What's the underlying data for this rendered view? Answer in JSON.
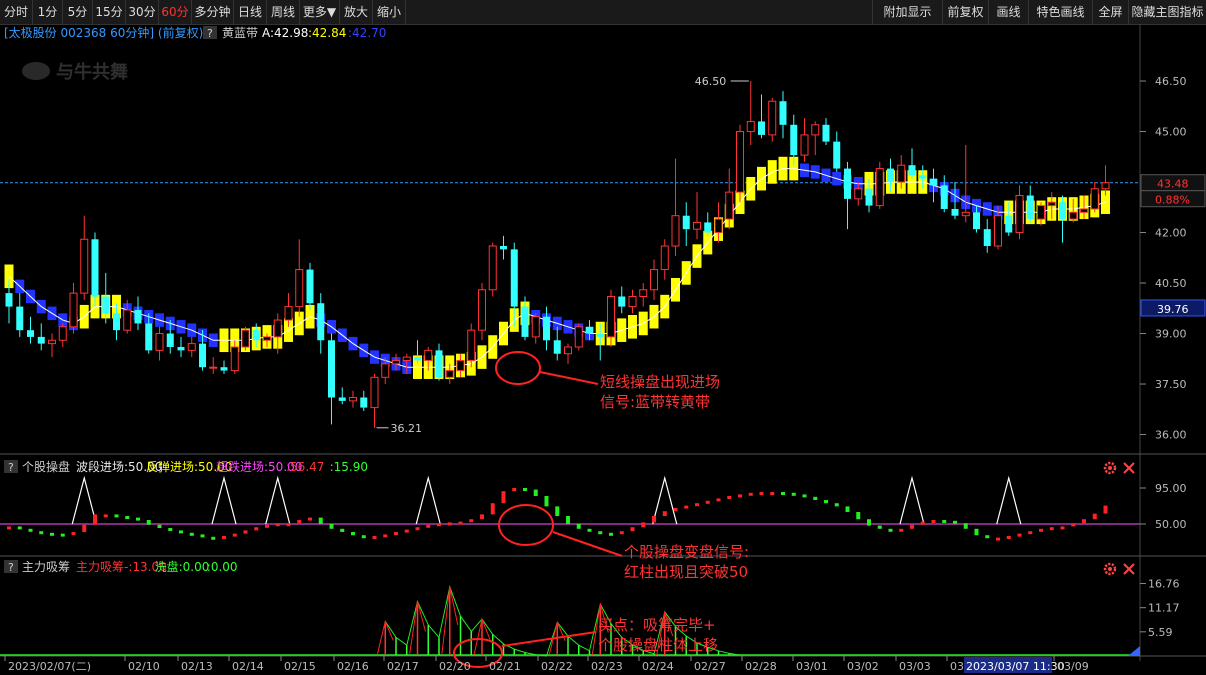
{
  "toolbar": {
    "left": [
      "分时",
      "1分",
      "5分",
      "15分",
      "30分",
      "60分",
      "多分钟",
      "日线",
      "周线",
      "更多▼",
      "放大",
      "缩小"
    ],
    "active": "60分",
    "right": [
      "附加显示",
      "前复权",
      "画线",
      "特色画线",
      "全屏",
      "隐藏主图指标"
    ]
  },
  "header": {
    "stock": "[太极股份 002368 60分钟] (前复权)",
    "help": "?",
    "indicator": "黄蓝带",
    "a_value": "A:42.98",
    "yellow_value": ":42.84",
    "blue_value": ":42.70"
  },
  "watermark": "与牛共舞",
  "price_panel": {
    "last_price": "43.48",
    "change": "0.88%",
    "bottom_tag": "39.76",
    "high_label": "46.50",
    "low_label": "36.21",
    "annotation_lines": [
      "短线操盘出现进场",
      "信号:蓝带转黄带"
    ]
  },
  "panel2": {
    "help": "?",
    "name": "个股操盘",
    "legend": [
      {
        "text": "波段进场:50.00",
        "color": "#e8e8e8"
      },
      {
        "text": "反弹进场:50.00",
        "color": "#ffff00"
      },
      {
        "text": "超跌进场:50.00",
        "color": "#ff44ff"
      },
      {
        "text": ":56.47",
        "color": "#ff3333"
      },
      {
        "text": ":15.90",
        "color": "#33ff33"
      }
    ],
    "annotation_lines": [
      "个股操盘变盘信号:",
      "红柱出现且突破50"
    ]
  },
  "panel3": {
    "help": "?",
    "name": "主力吸筹",
    "legend": [
      {
        "text": "主力吸筹-:13.00",
        "color": "#ff3333"
      },
      {
        "text": "洗盘:0.00",
        "color": "#33ff33"
      },
      {
        "text": ":0.00",
        "color": "#33ff33"
      }
    ],
    "annotation_lines": [
      "买点：吸筹完毕+",
      "个股操盘柱体上移"
    ]
  },
  "chart_data": [
    {
      "type": "candlestick",
      "title": "太极股份 002368 60分钟 (前复权)",
      "y_ticks": [
        "46.50",
        "45.00",
        "42.00",
        "40.50",
        "39.00",
        "37.50",
        "36.00"
      ],
      "ylim": [
        35.6,
        47.6
      ],
      "candles": [
        [
          40.2,
          40.6,
          39.3,
          39.8
        ],
        [
          39.8,
          40.2,
          38.9,
          39.1
        ],
        [
          39.1,
          39.5,
          38.7,
          38.9
        ],
        [
          38.9,
          39.3,
          38.5,
          38.7
        ],
        [
          38.7,
          39.0,
          38.3,
          38.8
        ],
        [
          38.8,
          39.3,
          38.6,
          39.2
        ],
        [
          39.2,
          40.5,
          39.0,
          40.2
        ],
        [
          40.2,
          42.5,
          40.0,
          41.8
        ],
        [
          41.8,
          42.0,
          39.8,
          40.1
        ],
        [
          40.1,
          40.8,
          39.3,
          39.6
        ],
        [
          39.6,
          39.9,
          38.8,
          39.1
        ],
        [
          39.1,
          40.0,
          39.0,
          39.7
        ],
        [
          39.7,
          40.1,
          39.1,
          39.3
        ],
        [
          39.3,
          39.6,
          38.4,
          38.5
        ],
        [
          38.5,
          39.2,
          38.2,
          39.0
        ],
        [
          39.0,
          39.4,
          38.4,
          38.6
        ],
        [
          38.6,
          38.9,
          38.3,
          38.5
        ],
        [
          38.5,
          38.9,
          38.3,
          38.7
        ],
        [
          38.7,
          39.1,
          37.9,
          38.0
        ],
        [
          38.0,
          38.3,
          37.8,
          38.0
        ],
        [
          38.0,
          38.2,
          37.8,
          37.9
        ],
        [
          37.9,
          38.8,
          37.8,
          38.6
        ],
        [
          38.6,
          39.2,
          38.5,
          39.1
        ],
        [
          39.1,
          39.3,
          38.6,
          38.8
        ],
        [
          38.8,
          39.0,
          38.6,
          38.9
        ],
        [
          38.9,
          39.6,
          38.4,
          39.4
        ],
        [
          39.4,
          40.2,
          39.2,
          39.8
        ],
        [
          39.8,
          41.8,
          39.5,
          40.9
        ],
        [
          40.9,
          41.1,
          39.7,
          39.9
        ],
        [
          39.9,
          40.2,
          38.4,
          38.8
        ],
        [
          38.8,
          39.0,
          36.3,
          37.1
        ],
        [
          37.1,
          37.4,
          36.9,
          37.0
        ],
        [
          37.0,
          37.3,
          36.8,
          37.1
        ],
        [
          37.1,
          37.3,
          36.7,
          36.8
        ],
        [
          36.8,
          37.8,
          36.2,
          37.7
        ],
        [
          37.7,
          38.3,
          37.5,
          38.1
        ],
        [
          38.1,
          38.4,
          37.9,
          38.2
        ],
        [
          38.2,
          38.4,
          37.8,
          38.3
        ],
        [
          38.3,
          38.8,
          38.1,
          38.2
        ],
        [
          38.2,
          38.6,
          37.9,
          38.5
        ],
        [
          38.5,
          38.7,
          37.6,
          37.7
        ],
        [
          37.7,
          38.1,
          37.5,
          37.9
        ],
        [
          37.9,
          38.4,
          37.7,
          38.2
        ],
        [
          38.2,
          39.3,
          38.0,
          39.1
        ],
        [
          39.1,
          40.5,
          38.8,
          40.3
        ],
        [
          40.3,
          41.7,
          40.1,
          41.6
        ],
        [
          41.6,
          41.9,
          41.2,
          41.5
        ],
        [
          41.5,
          41.7,
          39.2,
          39.8
        ],
        [
          39.8,
          40.1,
          38.8,
          38.9
        ],
        [
          38.9,
          39.6,
          38.7,
          39.5
        ],
        [
          39.5,
          39.8,
          38.5,
          38.8
        ],
        [
          38.8,
          39.2,
          38.2,
          38.4
        ],
        [
          38.4,
          38.7,
          38.1,
          38.6
        ],
        [
          38.6,
          39.3,
          38.5,
          39.2
        ],
        [
          39.2,
          39.4,
          38.8,
          39.0
        ],
        [
          39.0,
          39.3,
          38.2,
          38.9
        ],
        [
          38.9,
          40.3,
          38.6,
          40.1
        ],
        [
          40.1,
          40.4,
          39.6,
          39.8
        ],
        [
          39.8,
          40.3,
          39.6,
          40.1
        ],
        [
          40.1,
          40.5,
          39.8,
          40.3
        ],
        [
          40.3,
          41.2,
          40.0,
          40.9
        ],
        [
          40.9,
          41.8,
          40.6,
          41.6
        ],
        [
          41.6,
          44.2,
          41.3,
          42.5
        ],
        [
          42.5,
          42.9,
          41.6,
          42.1
        ],
        [
          42.1,
          43.2,
          41.8,
          42.3
        ],
        [
          42.3,
          42.6,
          41.9,
          42.0
        ],
        [
          42.0,
          42.9,
          41.7,
          42.4
        ],
        [
          42.4,
          43.9,
          42.1,
          43.2
        ],
        [
          43.2,
          45.2,
          42.9,
          45.0
        ],
        [
          45.0,
          46.5,
          44.6,
          45.3
        ],
        [
          45.3,
          46.1,
          44.8,
          44.9
        ],
        [
          44.9,
          46.0,
          44.7,
          45.9
        ],
        [
          45.9,
          46.2,
          44.8,
          45.2
        ],
        [
          45.2,
          45.5,
          44.0,
          44.3
        ],
        [
          44.3,
          45.4,
          44.1,
          44.9
        ],
        [
          44.9,
          45.3,
          44.3,
          45.2
        ],
        [
          45.2,
          45.4,
          44.6,
          44.7
        ],
        [
          44.7,
          45.0,
          43.8,
          43.9
        ],
        [
          43.9,
          44.1,
          42.1,
          43.0
        ],
        [
          43.0,
          43.5,
          42.8,
          43.3
        ],
        [
          43.3,
          43.6,
          42.6,
          42.8
        ],
        [
          42.8,
          44.1,
          42.7,
          43.9
        ],
        [
          43.9,
          44.2,
          43.2,
          43.5
        ],
        [
          43.5,
          44.3,
          43.3,
          44.0
        ],
        [
          44.0,
          44.5,
          43.6,
          43.7
        ],
        [
          43.7,
          44.0,
          43.3,
          43.6
        ],
        [
          43.6,
          43.9,
          42.9,
          43.4
        ],
        [
          43.4,
          43.7,
          42.6,
          42.7
        ],
        [
          42.7,
          43.5,
          42.4,
          42.5
        ],
        [
          42.5,
          44.6,
          42.3,
          42.6
        ],
        [
          42.6,
          42.8,
          42.0,
          42.1
        ],
        [
          42.1,
          42.4,
          41.4,
          41.6
        ],
        [
          41.6,
          42.8,
          41.5,
          42.5
        ],
        [
          42.5,
          42.9,
          41.9,
          42.0
        ],
        [
          42.0,
          43.4,
          41.8,
          43.1
        ],
        [
          43.1,
          43.4,
          42.3,
          42.4
        ],
        [
          42.4,
          42.9,
          42.2,
          42.8
        ],
        [
          42.8,
          43.2,
          42.4,
          42.9
        ],
        [
          42.9,
          43.1,
          41.7,
          42.4
        ],
        [
          42.4,
          43.0,
          42.3,
          42.6
        ],
        [
          42.6,
          43.1,
          42.4,
          42.7
        ],
        [
          42.7,
          43.5,
          42.6,
          43.3
        ],
        [
          43.3,
          44.0,
          43.1,
          43.48
        ]
      ],
      "band": [
        40.7,
        40.4,
        40.1,
        39.8,
        39.6,
        39.4,
        39.3,
        39.5,
        39.8,
        39.8,
        39.8,
        39.7,
        39.6,
        39.5,
        39.4,
        39.3,
        39.2,
        39.1,
        38.95,
        38.8,
        38.8,
        38.8,
        38.8,
        38.85,
        38.9,
        38.9,
        39.1,
        39.3,
        39.5,
        39.4,
        39.2,
        38.95,
        38.7,
        38.5,
        38.3,
        38.2,
        38.1,
        38.0,
        38.0,
        38.0,
        38.0,
        38.0,
        38.05,
        38.1,
        38.3,
        38.6,
        39.0,
        39.4,
        39.6,
        39.5,
        39.4,
        39.3,
        39.2,
        39.1,
        39.0,
        39.0,
        39.0,
        39.1,
        39.2,
        39.3,
        39.5,
        39.8,
        40.3,
        40.8,
        41.3,
        41.7,
        42.1,
        42.5,
        42.9,
        43.3,
        43.6,
        43.8,
        43.9,
        43.9,
        43.85,
        43.8,
        43.7,
        43.6,
        43.5,
        43.45,
        43.45,
        43.45,
        43.5,
        43.5,
        43.5,
        43.5,
        43.4,
        43.3,
        43.1,
        42.9,
        42.8,
        42.7,
        42.6,
        42.6,
        42.6,
        42.6,
        42.6,
        42.7,
        42.7,
        42.7,
        42.75,
        42.8,
        42.9
      ],
      "band_state": "yellow when rising, blue when falling"
    },
    {
      "type": "bar",
      "title": "个股操盘",
      "y_ticks": [
        "95.00",
        "50.00"
      ],
      "ylim": [
        15,
        110
      ],
      "signal_lines": {
        "波段进场": 50,
        "反弹进场": 50,
        "超跌进场": 50
      },
      "values": [
        47,
        44,
        41,
        39,
        38,
        37,
        40,
        49,
        62,
        62,
        60,
        58,
        55,
        49,
        45,
        42,
        39,
        37,
        34,
        33,
        35,
        38,
        42,
        46,
        49,
        51,
        51,
        55,
        58,
        50,
        44,
        40,
        36,
        34,
        35,
        37,
        40,
        43,
        46,
        49,
        51,
        52,
        53,
        56,
        62,
        76,
        91,
        95,
        93,
        85,
        72,
        60,
        50,
        44,
        41,
        39,
        38,
        41,
        46,
        52,
        60,
        66,
        70,
        73,
        76,
        79,
        82,
        85,
        87,
        89,
        90,
        90,
        89,
        87,
        84,
        80,
        76,
        72,
        65,
        56,
        48,
        44,
        42,
        44,
        49,
        53,
        55,
        54,
        51,
        44,
        36,
        33,
        33,
        35,
        38,
        41,
        44,
        46,
        47,
        51,
        56,
        63,
        73
      ]
    },
    {
      "type": "bar",
      "title": "主力吸筹",
      "x_ticks": [
        "2023/02/07(二)",
        "02/10",
        "02/13",
        "02/14",
        "02/15",
        "02/16",
        "02/17",
        "02/20",
        "02/21",
        "02/22",
        "02/23",
        "02/24",
        "02/27",
        "02/28",
        "03/01",
        "03/02",
        "03/03",
        "03/06",
        "2023/03/07 11:30",
        "03/09"
      ],
      "y_ticks": [
        "16.76",
        "11.17",
        "5.59"
      ],
      "ylim": [
        0,
        18.5
      ],
      "x_start_index": 35,
      "values": [
        8.0,
        4.3,
        2.5,
        12.6,
        7.2,
        4.3,
        16.0,
        9.2,
        5.7,
        8.5,
        5.0,
        2.8,
        1.6,
        0.8,
        0.3,
        0.0,
        7.8,
        4.6,
        2.5,
        1.2,
        12.0,
        7.5,
        4.3,
        2.6,
        1.3,
        0.5,
        10.2,
        6.8,
        4.6,
        3.0,
        2.0,
        1.2,
        0.6,
        0.2
      ],
      "lines": [
        {
          "name": "主力吸筹",
          "color": "#ff3333",
          "values": [
            8.0,
            0,
            0,
            12.6,
            0,
            0,
            16.0,
            0,
            0,
            8.5,
            0,
            0,
            0,
            0,
            0,
            0,
            7.8,
            0,
            0,
            0,
            12.0,
            0,
            0,
            0,
            0,
            0,
            10.2,
            0,
            0,
            0,
            0,
            0,
            0,
            0
          ]
        },
        {
          "name": "洗盘",
          "color": "#33ff33",
          "values": [
            0,
            4.3,
            2.5,
            0,
            7.2,
            4.3,
            0,
            9.2,
            5.7,
            0,
            5.0,
            2.8,
            1.6,
            0.8,
            0.3,
            0.0,
            0,
            4.6,
            2.5,
            1.2,
            0,
            7.5,
            4.3,
            2.6,
            1.3,
            0.5,
            0,
            6.8,
            4.6,
            3.0,
            2.0,
            1.2,
            0.6,
            0.2
          ]
        }
      ]
    }
  ]
}
